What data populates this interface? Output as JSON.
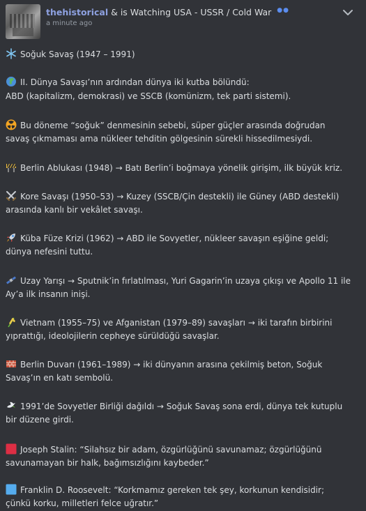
{
  "post": {
    "username": "thehistorical",
    "activity": "& is Watching USA - USSR / Cold War",
    "time": "a minute ago"
  },
  "lines": [
    {
      "icon": "snowflake-icon",
      "text": "Soğuk Savaş (1947 – 1991)"
    },
    {
      "icon": "globe-icon",
      "text": "II. Dünya Savaşı’nın ardından dünya iki kutba bölündü:"
    },
    {
      "icon": "",
      "text": "ABD (kapitalizm, demokrasi) ve SSCB (komünizm, tek parti sistemi)."
    },
    {
      "icon": "radioactive-icon",
      "text": "Bu döneme “soğuk” denmesinin sebebi, süper güçler arasında doğrudan"
    },
    {
      "icon": "",
      "text": "savaş çıkmaması ama nükleer tehditin gölgesinin sürekli hissedilmesiydi."
    },
    {
      "icon": "construction-barrier-icon",
      "text": "Berlin Ablukası (1948) → Batı Berlin’i boğmaya yönelik girişim, ilk büyük kriz."
    },
    {
      "icon": "crossed-swords-icon",
      "text": "Kore Savaşı (1950–53) → Kuzey (SSCB/Çin destekli) ile Güney (ABD destekli)"
    },
    {
      "icon": "",
      "text": "arasında kanlı bir vekâlet savaşı."
    },
    {
      "icon": "rocket-icon",
      "text": "Küba Füze Krizi (1962) → ABD ile Sovyetler, nükleer savaşın eşiğine geldi;"
    },
    {
      "icon": "",
      "text": "dünya nefesini tuttu."
    },
    {
      "icon": "satellite-icon",
      "text": "Uzay Yarışı → Sputnik’in fırlatılması, Yuri Gagarin’in uzaya çıkışı ve Apollo 11 ile"
    },
    {
      "icon": "",
      "text": "Ay’a ilk insanın inişi."
    },
    {
      "icon": "rice-stalk-icon",
      "text": "Vietnam (1955–75) ve Afganistan (1979–89) savaşları → iki tarafın birbirini"
    },
    {
      "icon": "",
      "text": "yıprattığı, ideolojilerin cepheye sürüldüğü savaşlar."
    },
    {
      "icon": "brick-icon",
      "text": "Berlin Duvarı (1961–1989) → iki dünyanın arasına çekilmiş beton, Soğuk"
    },
    {
      "icon": "",
      "text": "Savaş’ın en katı sembolü."
    },
    {
      "icon": "dove-icon",
      "text": "1991’de Sovyetler Birliği dağıldı → Soğuk Savaş sona erdi, dünya tek kutuplu"
    },
    {
      "icon": "",
      "text": "bir düzene girdi."
    },
    {
      "icon": "red-square-icon",
      "text": "Joseph Stalin: “Silahsız bir adam, özgürlüğünü savunamaz; özgürlüğünü"
    },
    {
      "icon": "",
      "text": "savunamayan bir halk, bağımsızlığını kaybeder.”"
    },
    {
      "icon": "blue-square-icon",
      "text": "Franklin D. Roosevelt: “Korkmamız gereken tek şey, korkunun kendisidir;"
    },
    {
      "icon": "",
      "text": "çünkü korku, milletleri felce uğratır.”"
    }
  ],
  "colors": {
    "background": "#313338",
    "username": "#8ea1e1",
    "text": "#dbdee1",
    "muted": "#949ba4"
  }
}
